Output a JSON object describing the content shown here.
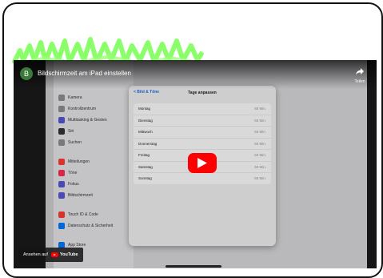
{
  "video": {
    "channel_initial": "B",
    "title": "Bildschirmzeit am iPad einstellen",
    "share_label": "Teilen",
    "watch_on": "Ansehen auf",
    "platform": "YouTube"
  },
  "settings_sidebar": {
    "items": [
      {
        "label": "Kamera",
        "color": "#8e8e93"
      },
      {
        "label": "Kontrollzentrum",
        "color": "#8e8e93"
      },
      {
        "label": "Multitasking & Gesten",
        "color": "#5856d6"
      },
      {
        "label": "Siri",
        "color": "#333333"
      },
      {
        "label": "Suchen",
        "color": "#8e8e93"
      },
      {
        "label": "Mitteilungen",
        "color": "#ff3b30"
      },
      {
        "label": "Töne",
        "color": "#ff2d55"
      },
      {
        "label": "Fokus",
        "color": "#5856d6"
      },
      {
        "label": "Bildschirmzeit",
        "color": "#5856d6"
      },
      {
        "label": "Touch ID & Code",
        "color": "#ff3b30"
      },
      {
        "label": "Datenschutz & Sicherheit",
        "color": "#007aff"
      },
      {
        "label": "App Store",
        "color": "#007aff"
      }
    ]
  },
  "modal": {
    "back_label": "< Bild & Töne",
    "title": "Tage anpassen",
    "days": [
      {
        "day": "Montag",
        "value": "60 Min."
      },
      {
        "day": "Dienstag",
        "value": "60 Min."
      },
      {
        "day": "Mittwoch",
        "value": "60 Min."
      },
      {
        "day": "Donnerstag",
        "value": "60 Min."
      },
      {
        "day": "Freitag",
        "value": "60 Min."
      },
      {
        "day": "Samstag",
        "value": "60 Min."
      },
      {
        "day": "Sonntag",
        "value": "60 Min."
      }
    ]
  },
  "colors": {
    "accent": "#ff0000",
    "highlight": "#7dff5a"
  }
}
